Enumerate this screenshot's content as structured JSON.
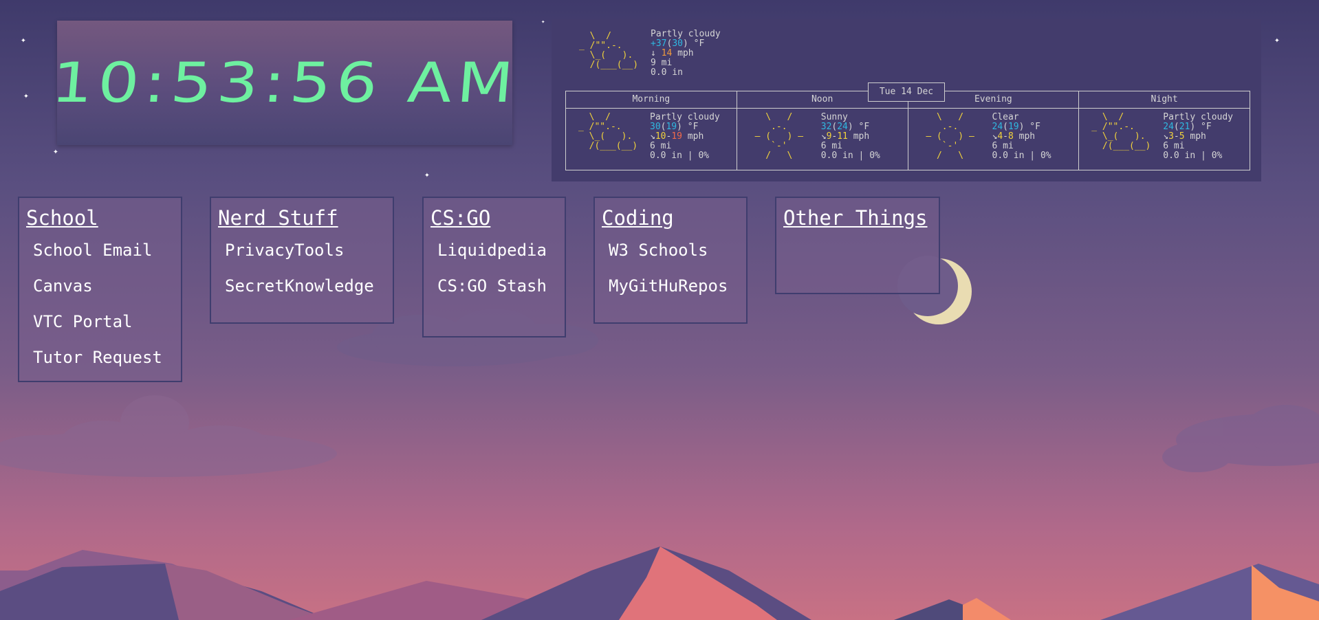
{
  "clock": {
    "time": "10:53:56 AM"
  },
  "weather": {
    "current": {
      "art": [
        "  \\  /",
        "_ /\"\".-.",
        "  \\_(   ).",
        "  /(___(__)"
      ],
      "condition": "Partly cloudy",
      "temp": "+37",
      "temp_feel": "30",
      "temp_unit": "°F",
      "wind_arrow": "↓",
      "wind": "14",
      "wind_unit": "mph",
      "visibility": "9 mi",
      "precip": "0.0 in"
    },
    "date": "Tue 14 Dec",
    "periods": [
      {
        "label": "Morning",
        "art": [
          "  \\  /",
          "_ /\"\".-.",
          "  \\_(   ).",
          "  /(___(__)"
        ],
        "condition": "Partly cloudy",
        "temp": "30",
        "temp_feel": "19",
        "wind": "10-19",
        "visibility": "6 mi",
        "precip": "0.0 in | 0%"
      },
      {
        "label": "Noon",
        "art": [
          "   \\   /",
          "    .-.",
          " ― (   ) ―",
          "    `-'",
          "   /   \\"
        ],
        "condition": "Sunny",
        "temp": "32",
        "temp_feel": "24",
        "wind": "9-11",
        "visibility": "6 mi",
        "precip": "0.0 in | 0%"
      },
      {
        "label": "Evening",
        "art": [
          "   \\   /",
          "    .-.",
          " ― (   ) ―",
          "    `-'",
          "   /   \\"
        ],
        "condition": "Clear",
        "temp": "24",
        "temp_feel": "19",
        "wind": "4-8",
        "visibility": "6 mi",
        "precip": "0.0 in | 0%"
      },
      {
        "label": "Night",
        "art": [
          "  \\  /",
          "_ /\"\".-.",
          "  \\_(   ).",
          "  /(___(__)"
        ],
        "condition": "Partly cloudy",
        "temp": "24",
        "temp_feel": "21",
        "wind": "3-5",
        "visibility": "6 mi",
        "precip": "0.0 in | 0%"
      }
    ],
    "unit_temp": "°F",
    "unit_wind": "mph",
    "wind_arrow": "↘"
  },
  "bookmarks": [
    {
      "title": "School",
      "links": [
        "School Email",
        "Canvas",
        "VTC Portal",
        "Tutor Request"
      ]
    },
    {
      "title": "Nerd Stuff",
      "links": [
        "PrivacyTools",
        "SecretKnowledge"
      ]
    },
    {
      "title": "CS:GO",
      "links": [
        "Liquidpedia",
        "CS:GO Stash"
      ]
    },
    {
      "title": "Coding",
      "links": [
        "W3 Schools",
        "MyGitHuRepos"
      ]
    },
    {
      "title": "Other Things",
      "links": []
    }
  ],
  "colors": {
    "clock": "#6ef0a0",
    "accent_yellow": "#f2d33b",
    "accent_cyan": "#2fb8e0",
    "accent_orange": "#f09a3c",
    "accent_red": "#f06a4a"
  }
}
